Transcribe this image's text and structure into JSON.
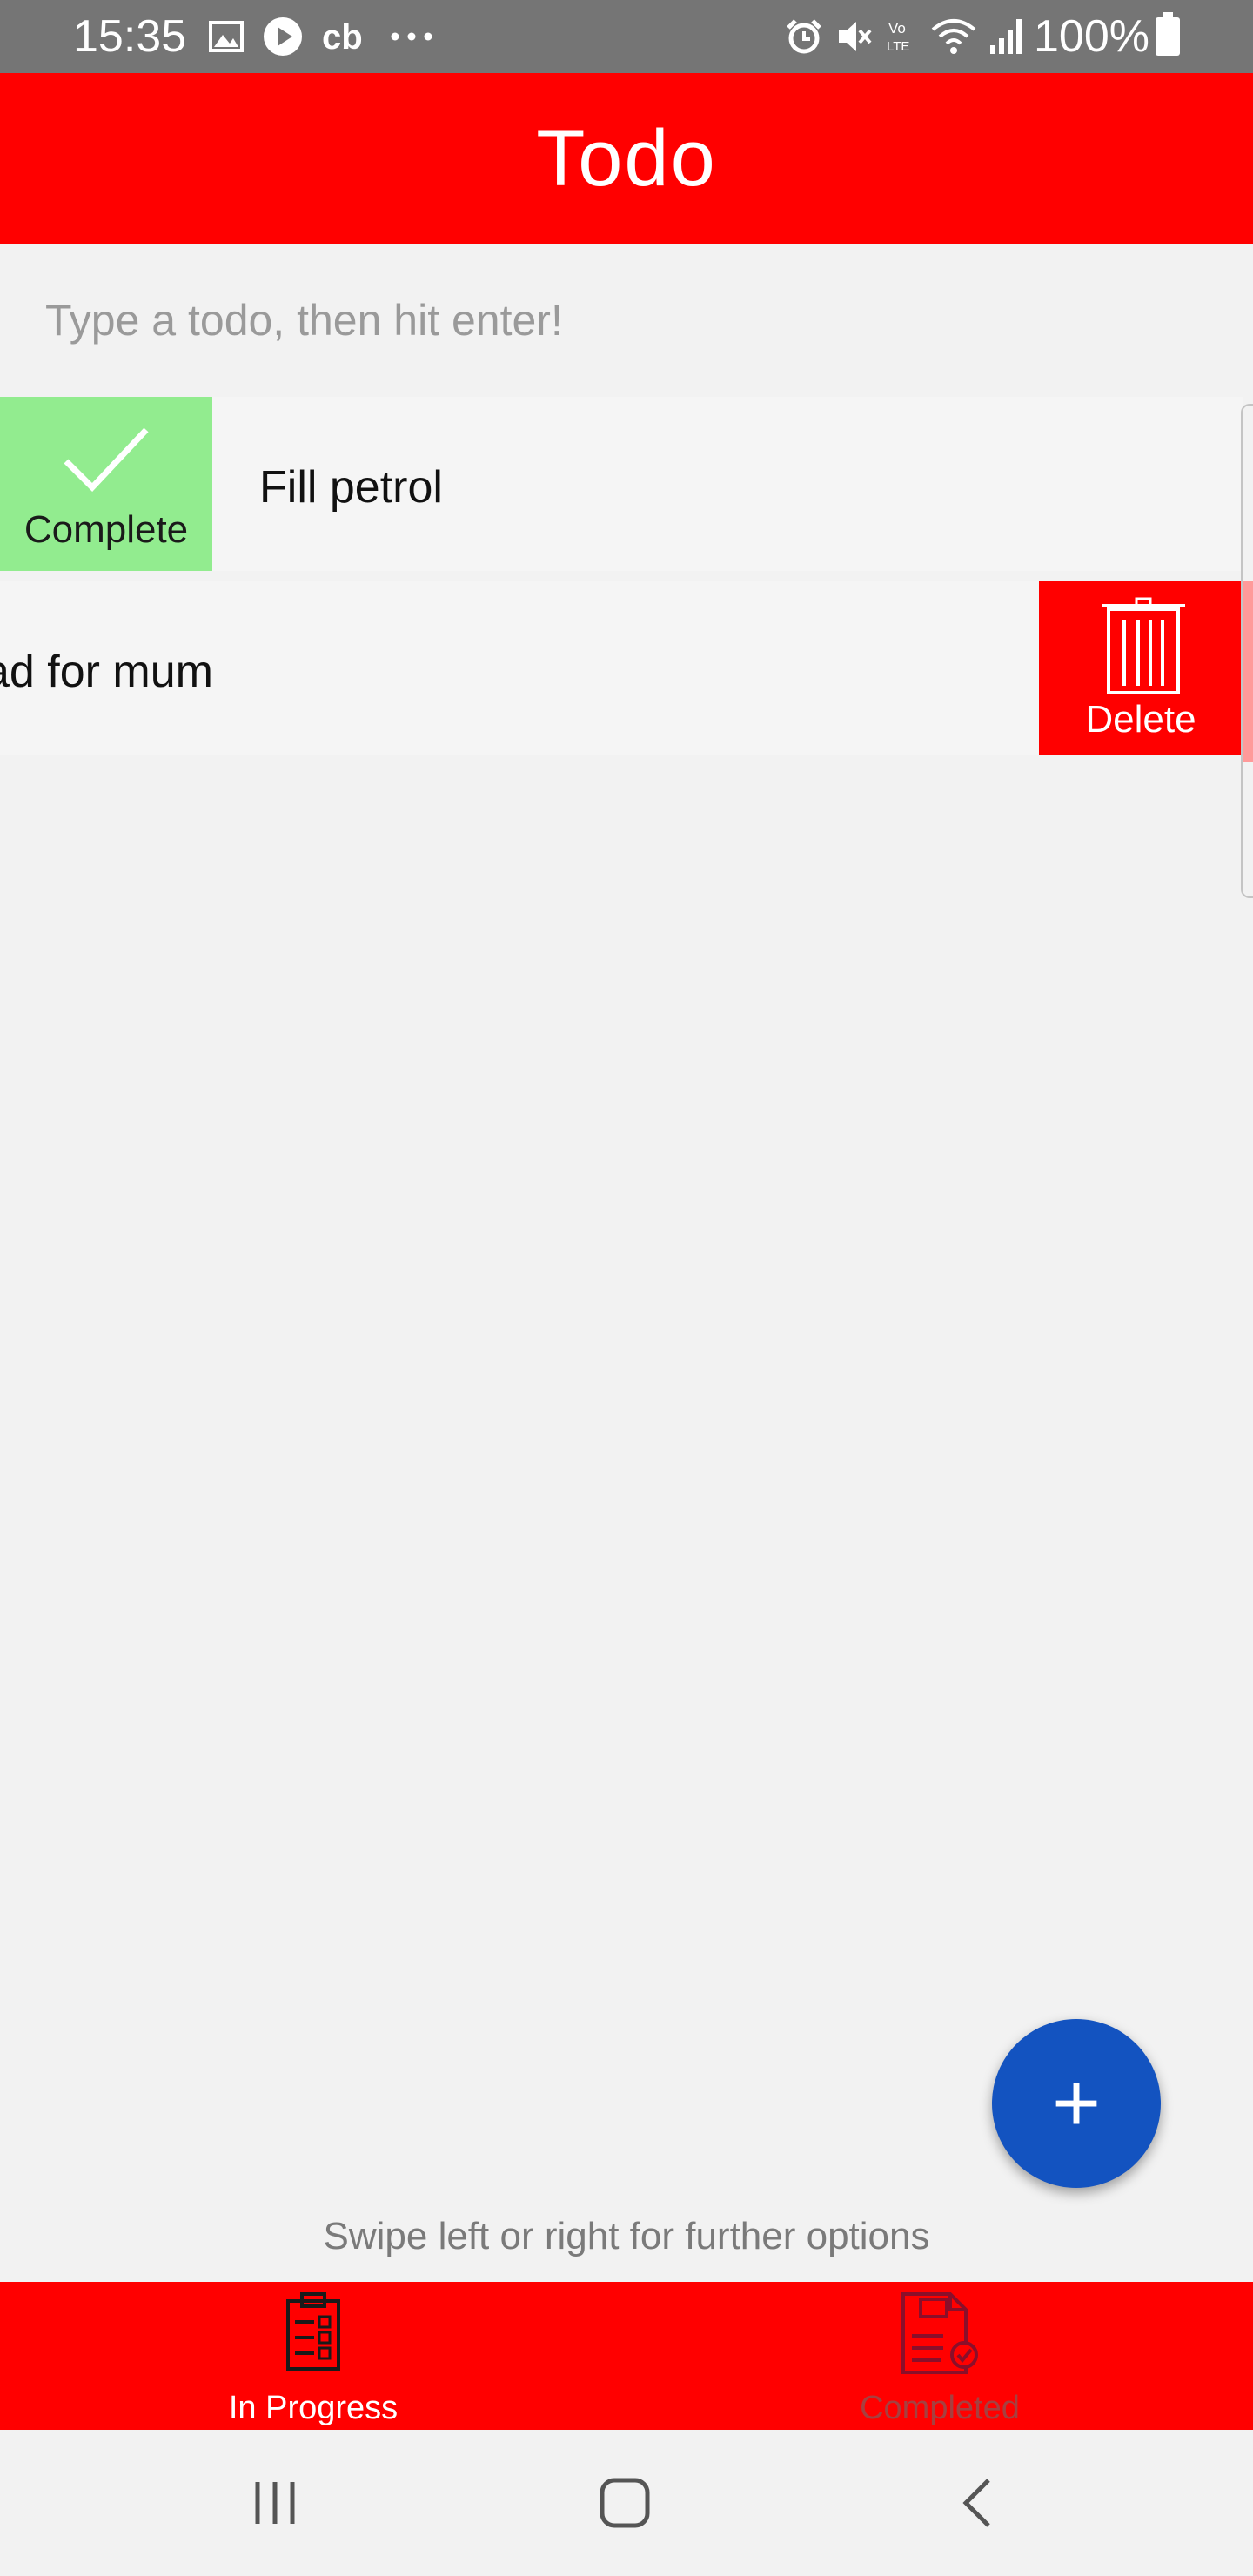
{
  "status_bar": {
    "time": "15:35",
    "left_icons": [
      "image-icon",
      "play-icon",
      "cb-icon",
      "more-icon"
    ],
    "right_icons": [
      "alarm-icon",
      "mute-icon",
      "volte-icon",
      "wifi-icon",
      "signal-icon"
    ],
    "battery": "100%"
  },
  "app_bar": {
    "title": "Todo"
  },
  "input": {
    "placeholder": "Type a todo, then hit enter!",
    "value": ""
  },
  "todos": [
    {
      "text": "Fill petrol",
      "action_label": "Complete",
      "action_icon": "check-icon",
      "action_color": "#92ec8f"
    },
    {
      "text": "ad for mum",
      "action_label": "Delete",
      "action_icon": "trash-icon",
      "action_color": "#ff0000"
    }
  ],
  "fab": {
    "label": "+",
    "color": "#1353c0"
  },
  "hint": "Swipe left or right for further options",
  "bottom_nav": {
    "items": [
      {
        "label": "In Progress",
        "icon": "clipboard-list-icon",
        "active": true
      },
      {
        "label": "Completed",
        "icon": "document-check-icon",
        "active": false
      }
    ]
  },
  "system_nav": {
    "buttons": [
      "recents-icon",
      "home-icon",
      "back-icon"
    ]
  },
  "colors": {
    "primary": "#ff0000",
    "accent": "#1353c0",
    "complete": "#92ec8f",
    "background": "#f2f2f2"
  }
}
